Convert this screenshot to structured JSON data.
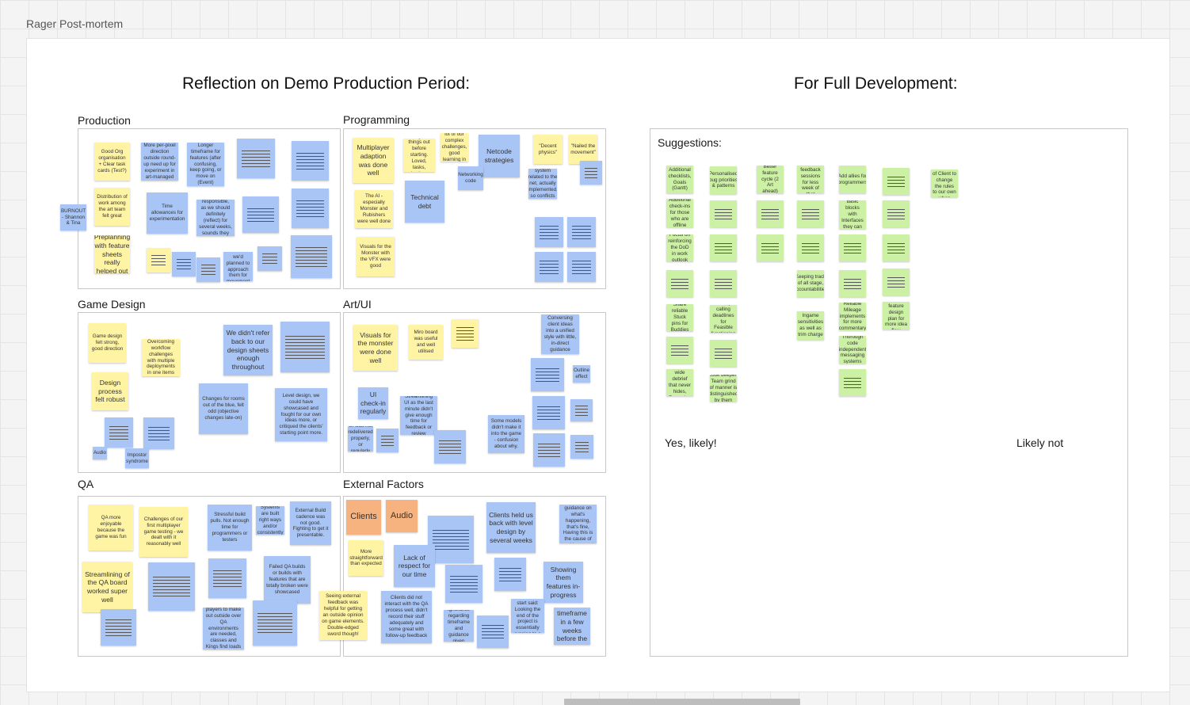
{
  "board": {
    "title": "Rager Post-mortem"
  },
  "headings": {
    "left": "Reflection on Demo Production Period:",
    "right": "For Full Development:"
  },
  "sections": {
    "production": "Production",
    "programming": "Programming",
    "game_design": "Game Design",
    "art_ui": "Art/UI",
    "qa": "QA",
    "external": "External Factors",
    "suggestions": "Suggestions:"
  },
  "columns": {
    "yes": "Yes, likely!",
    "no": "Likely not"
  },
  "notes": {
    "prod": [
      "Good Org organisation + Clear task cards (Test?)",
      "More per-pixel direction outside round-up need up for experiment in art-managed",
      "Longer timeframe for features (after confusing, keep going, or move on (Event)",
      "BURNOUT - Shannon & Tina",
      "Distribution of work among the art team felt great",
      "Time allowances for experimentation",
      "Had sidebar plugins use responsible, as we should definitely (reflect) for several weeks, sounds they deals on in original scope",
      "Preplanning with feature sheets really helped out",
      "Couldn't look like we'd planned to approach them for movement completion"
    ],
    "prog": [
      "Multiplayer adaption was done well",
      "Took a while trying to figure things out before starting. Loved, tasks, looting, along more efficient",
      "Solved a lot of our complex challenges, good learning in tools",
      "Netcode strategies",
      "\"Decent physics\"",
      "\"Nailed the movement\"",
      "Networking code",
      "Technical debt",
      "Physics system related to the net, actually implemented, so conflicts done it",
      "The AI - especially Monster and Rubishers were well done",
      "Visuals for the Monster with the VFX were good"
    ],
    "design": [
      "Game design felt strong, good direction",
      "Overcoming workflow challenges with multiple deployments in one items",
      "We didn't refer back to our design sheets enough throughout",
      "Design process felt robust",
      "Changes for rooms out of the blue, felt odd (objective changes late-on)",
      "Level design, we could have showcased and fought for our own ideas more, or critiqued the clients' starting point more.",
      "Audio",
      "Impostor syndrome"
    ],
    "art": [
      "Visuals for the monster were done well",
      "Miro board was useful and well utilised",
      "Conversing client ideas into a unified style with little, in-direct guidance",
      "UI check-in regularly",
      "Streamlining UI as the last minute didn't give enough time for feedback or review",
      "Outline effect",
      "Some models didn't make it into the game - confusion about why.",
      "UI was not redelivered properly, or regularly"
    ],
    "qa": [
      "QA more enjoyable because the game was fun",
      "Challenges of our first multiplayer game testing - we dealt with it reasonably well",
      "Stressful build pulls. Not enough time for programmers or testers",
      "Systems are built right ways and/or consistently",
      "External Build cadence was not good. Fighting to get it presentable.",
      "Streamlining of the QA board worked super well",
      "Failed QA builds or builds with features that are totally broken were showcased",
      "Lost trouble the players to make out outside over QA environments are needed, classes and Kings find loads in a working",
      "Seeing external feedback was helpful for getting an outside opinion on game elements. Double-edged sword though!"
    ],
    "ext": [
      "Clients",
      "Audio",
      "Clients held us back with level design by several weeks",
      "Clients didn't give clear guidance on what's happening, that's fine, Having this is the cause of problems and will resolve",
      "More straightforward than expected",
      "Lack of respect for our time",
      "Showing them features in-progress",
      "Clients did not interact with the QA process well, didn't record their stuff adequately and some great with follow-up feedback",
      "Ignorance regarding timeframe and guidance given",
      "Resolving for hold at start said: Looking the end of the project is essentially running to a schedule",
      "Lack of timeframe in a few weeks before the end"
    ],
    "sugg": [
      "Additional checklists, Goals (Gantt)",
      "Personalised bug priorities & patterns",
      "Better feature cycle (2 Art ahead)",
      "Client feedback sessions for less week of that",
      "Add allies for programmers",
      "Limitations of Client to change the rules to our own when",
      "Additional check-ins for those who are offline",
      "Add previously basic blocks with Interfaces they can be our libraries",
      "Focus on reinforcing the DoD in work outlook",
      "Keeping track of all stage, accountabilities",
      "Share reliable Stuck pins for Buddies",
      "Clearly calling deadlines for Feasible functioning",
      "Ingame sensitivities as well as trim charge",
      "Reliable Mileage implements for more commentary",
      "Nested feature design plan for more idea flow",
      "Thorough code independent messaging systems",
      "Team-wide debrief that never hides, Forceplan",
      "Look deeper: Team grind of manner is distinguished by them"
    ]
  }
}
